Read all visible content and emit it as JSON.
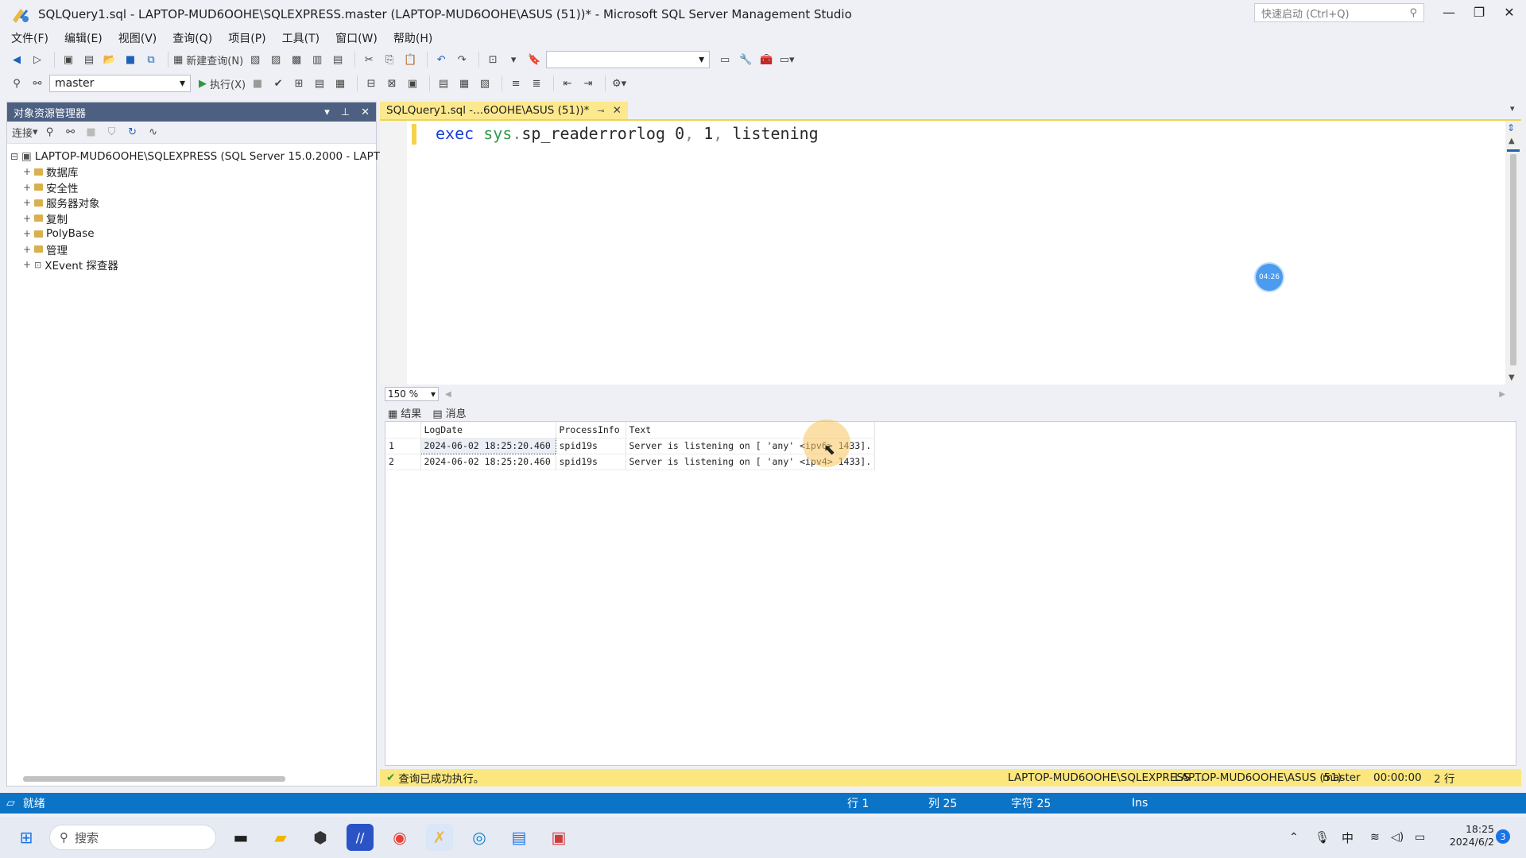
{
  "window": {
    "title": "SQLQuery1.sql - LAPTOP-MUD6OOHE\\SQLEXPRESS.master (LAPTOP-MUD6OOHE\\ASUS (51))* - Microsoft SQL Server Management Studio",
    "quicklaunch_placeholder": "快速启动 (Ctrl+Q)"
  },
  "menu": [
    "文件(F)",
    "编辑(E)",
    "视图(V)",
    "查询(Q)",
    "项目(P)",
    "工具(T)",
    "窗口(W)",
    "帮助(H)"
  ],
  "toolbar": {
    "new_query_label": "新建查询(N)",
    "database": "master",
    "execute_label": "执行(X)"
  },
  "object_explorer": {
    "title": "对象资源管理器",
    "connect_label": "连接",
    "server": "LAPTOP-MUD6OOHE\\SQLEXPRESS (SQL Server 15.0.2000 - LAPTO",
    "nodes": [
      "数据库",
      "安全性",
      "服务器对象",
      "复制",
      "PolyBase",
      "管理",
      "XEvent 探查器"
    ]
  },
  "editor": {
    "tab_label": "SQLQuery1.sql -...6OOHE\\ASUS (51))*",
    "code": "exec sys.sp_readerrorlog 0, 1, listening",
    "zoom": "150 %",
    "timer_badge": "04:26"
  },
  "results": {
    "tab_results": "结果",
    "tab_messages": "消息",
    "columns": [
      "LogDate",
      "ProcessInfo",
      "Text"
    ],
    "rows": [
      {
        "num": "1",
        "LogDate": "2024-06-02 18:25:20.460",
        "ProcessInfo": "spid19s",
        "Text": "Server is listening on [ 'any' <ipv6> 1433]."
      },
      {
        "num": "2",
        "LogDate": "2024-06-02 18:25:20.460",
        "ProcessInfo": "spid19s",
        "Text": "Server is listening on [ 'any' <ipv4> 1433]."
      }
    ]
  },
  "query_status": {
    "message": "查询已成功执行。",
    "server": "LAPTOP-MUD6OOHE\\SQLEXPRESS ...",
    "user": "LAPTOP-MUD6OOHE\\ASUS (51)",
    "database": "master",
    "elapsed": "00:00:00",
    "rows": "2 行"
  },
  "statusbar": {
    "ready": "就绪",
    "line": "行 1",
    "col": "列 25",
    "char": "字符 25",
    "mode": "Ins"
  },
  "taskbar": {
    "search_label": "搜索",
    "time": "18:25",
    "date": "2024/6/2",
    "ime": "中",
    "notification_count": "3"
  },
  "colors": {
    "accent_blue": "#0c74c7",
    "active_tab_yellow": "#fce98e",
    "panel_header": "#4d6082"
  }
}
